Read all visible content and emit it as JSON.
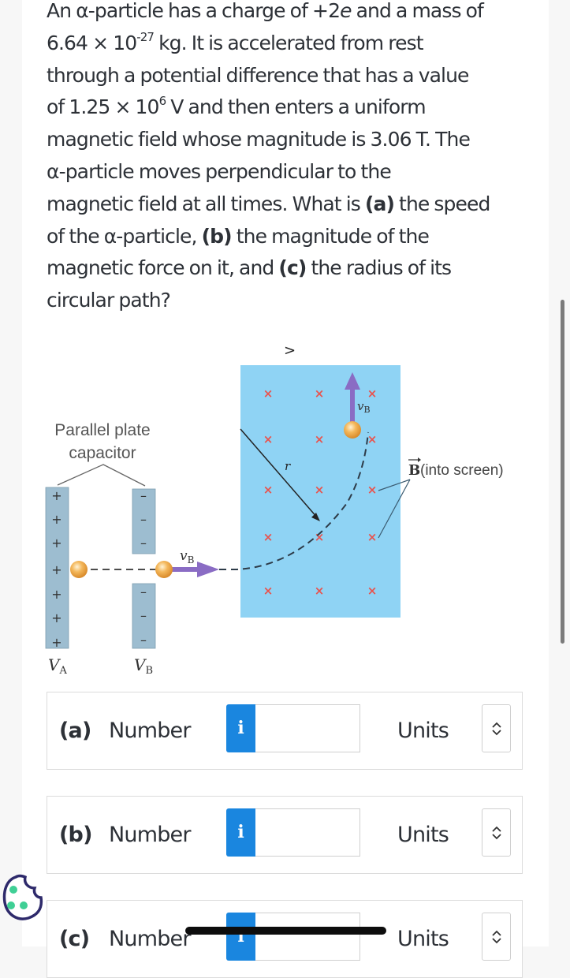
{
  "question": {
    "line1_pre": "An α-particle has a charge of +2",
    "line1_e": "e",
    "line1_post": " and a mass of",
    "mass_mantissa": "6.64 × 10",
    "mass_exponent": "-27",
    "line2_post": " kg. It is accelerated from rest",
    "line3": "through a potential difference that has a value",
    "voltage_pre": "of 1.25 × 10",
    "voltage_exponent": "6",
    "line4_post": " V and then enters a uniform",
    "line5": "magnetic field whose magnitude is 3.06 T. The",
    "line6": "α-particle moves perpendicular to the",
    "line7_pre": "magnetic field at all times. What is ",
    "part_a": "(a)",
    "line7_post": " the speed",
    "line8_pre": "of the α-particle, ",
    "part_b": "(b)",
    "line8_post": " the magnitude of the",
    "line9_pre": "magnetic force on it, and ",
    "part_c": "(c)",
    "line9_post": " the radius of its",
    "line10": "circular path?"
  },
  "figure": {
    "capacitor_label_line1": "Parallel plate",
    "capacitor_label_line2": "capacitor",
    "plate_a_label_main": "V",
    "plate_a_label_sub": "A",
    "plate_b_label_main": "V",
    "plate_b_label_sub": "B",
    "velocity_label_main": "v",
    "velocity_label_sub": "B",
    "radius_label": "r",
    "field_label_symbol": "B",
    "field_label_text": " (into screen)",
    "nav_glyph": ">",
    "plate_a_sign": "+",
    "plate_b_sign": "–",
    "field_mark": "×",
    "colors": {
      "field_region": "#8fd3f4",
      "plate": "#9dbdd0",
      "field_mark": "#e8544f",
      "velocity_arrow": "#8a6cc4",
      "particle": "#f0b35a"
    }
  },
  "answers": [
    {
      "part": "(a)",
      "number_label": "Number",
      "info_icon": "i",
      "value": "",
      "units_label": "Units"
    },
    {
      "part": "(b)",
      "number_label": "Number",
      "info_icon": "i",
      "value": "",
      "units_label": "Units"
    },
    {
      "part": "(c)",
      "number_label": "Number",
      "info_icon": "i",
      "value": "",
      "units_label": "Units"
    }
  ],
  "colors": {
    "info_button": "#1a86df",
    "text": "#2d3137",
    "cookie_outline": "#2e2a6b",
    "cookie_dots": "#3fcf95"
  }
}
